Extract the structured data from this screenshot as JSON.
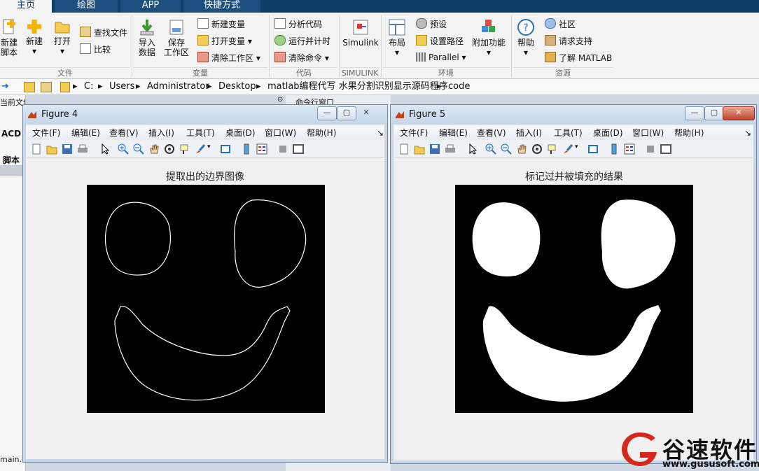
{
  "tabs": [
    {
      "label": "主页",
      "active": true
    },
    {
      "label": "绘图",
      "active": false
    },
    {
      "label": "APP",
      "active": false
    },
    {
      "label": "快捷方式",
      "active": false
    }
  ],
  "ribbon": {
    "file": {
      "new_script": "新建\n脚本",
      "new": "新建",
      "open": "打开",
      "find_files": "查找文件",
      "compare": "比较",
      "group": "文件"
    },
    "variable": {
      "import": "导入\n数据",
      "save_ws": "保存\n工作区",
      "new_var": "新建变量",
      "open_var": "打开变量",
      "clear_ws": "清除工作区",
      "group": "变量"
    },
    "code": {
      "analyze": "分析代码",
      "run_time": "运行并计时",
      "clear_cmd": "清除命令",
      "group": "代码"
    },
    "simulink": {
      "label": "Simulink",
      "group": "SIMULINK"
    },
    "env": {
      "layout": "布局",
      "prefs": "预设",
      "set_path": "设置路径",
      "parallel": "Parallel",
      "addons": "附加功能",
      "group": "环境"
    },
    "resources": {
      "help": "帮助",
      "community": "社区",
      "support": "请求支持",
      "learn": "了解 MATLAB",
      "group": "资源"
    }
  },
  "address": {
    "crumbs": [
      "C:",
      "Users",
      "Administrator",
      "Desktop",
      "matlab编程代写 水果分割识别显示源码程序",
      "code"
    ]
  },
  "panels": {
    "current_folder": "当前文件夹",
    "command_window": "命令行窗口",
    "acd": "ACD",
    "script": "脚本",
    "main_file": "main.m"
  },
  "figures": [
    {
      "title": "Figure 4",
      "menu": [
        "文件(F)",
        "编辑(E)",
        "查看(V)",
        "插入(I)",
        "工具(T)",
        "桌面(D)",
        "窗口(W)",
        "帮助(H)"
      ],
      "plot_title": "提取出的边界图像"
    },
    {
      "title": "Figure 5",
      "menu": [
        "文件(F)",
        "编辑(E)",
        "查看(V)",
        "插入(I)",
        "工具(T)",
        "桌面(D)",
        "窗口(W)",
        "帮助(H)"
      ],
      "plot_title": "标记过并被填充的结果"
    }
  ],
  "watermark": {
    "text": "谷速软件",
    "url": "www.gususoft.com"
  }
}
